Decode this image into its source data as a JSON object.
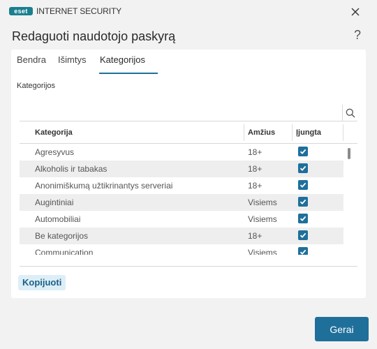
{
  "window": {
    "logo_text": "eset",
    "product_name": "INTERNET SECURITY",
    "close_glyph": "close-icon"
  },
  "header": {
    "title": "Redaguoti naudotojo paskyrą",
    "help_label": "?"
  },
  "tabs": [
    {
      "label": "Bendra",
      "active": false
    },
    {
      "label": "Išimtys",
      "active": false
    },
    {
      "label": "Kategorijos",
      "active": true
    }
  ],
  "section": {
    "label": "Kategorijos"
  },
  "search": {
    "placeholder": "",
    "value": ""
  },
  "table": {
    "columns": [
      "Kategorija",
      "Amžius",
      "Įjungta"
    ],
    "rows": [
      {
        "category": "Agresyvus",
        "age": "18+",
        "enabled": true
      },
      {
        "category": "Alkoholis ir tabakas",
        "age": "18+",
        "enabled": true
      },
      {
        "category": "Anonimiškumą užtikrinantys serveriai",
        "age": "18+",
        "enabled": true
      },
      {
        "category": "Augintiniai",
        "age": "Visiems",
        "enabled": true
      },
      {
        "category": "Automobiliai",
        "age": "Visiems",
        "enabled": true
      },
      {
        "category": "Be kategorijos",
        "age": "18+",
        "enabled": true
      },
      {
        "category": "Communication",
        "age": "Visiems",
        "enabled": true
      }
    ]
  },
  "footer": {
    "copy_label": "Kopijuoti",
    "ok_label": "Gerai"
  },
  "colors": {
    "accent": "#1f6f9b",
    "brand": "#1a7f8e",
    "row_alt": "#eeeeee"
  }
}
